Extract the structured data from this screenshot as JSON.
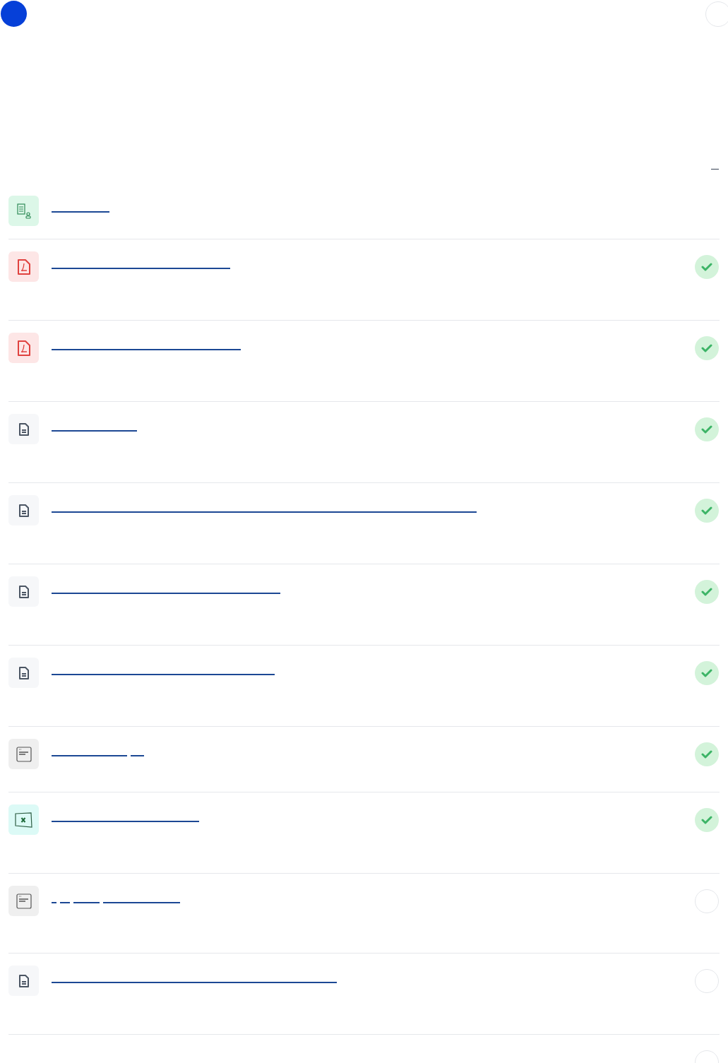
{
  "items": [
    {
      "kind": "contact"
    },
    {
      "kind": "pdf",
      "completed": true
    },
    {
      "kind": "pdf",
      "completed": true
    },
    {
      "kind": "doc",
      "completed": true
    },
    {
      "kind": "doc",
      "completed": true
    },
    {
      "kind": "doc",
      "completed": true
    },
    {
      "kind": "doc",
      "completed": true
    },
    {
      "kind": "note",
      "completed": true
    },
    {
      "kind": "sheet",
      "completed": true
    },
    {
      "kind": "note",
      "completed": false
    },
    {
      "kind": "doc",
      "completed": false
    },
    {
      "kind": "blank",
      "completed": false
    }
  ]
}
